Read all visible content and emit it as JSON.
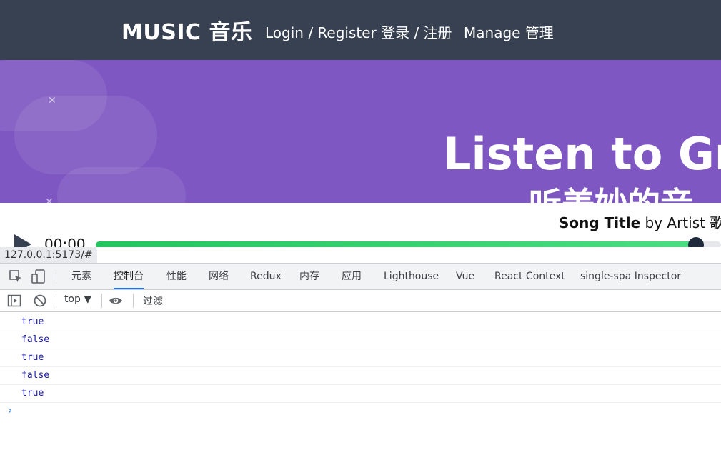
{
  "nav": {
    "brand": "MUSIC 音乐",
    "login": "Login / Register 登录 / 注册",
    "manage": "Manage 管理"
  },
  "hero": {
    "title": "Listen to Grea",
    "subtitle": "听美妙的音"
  },
  "player": {
    "song_title": "Song Title",
    "by_artist": " by Artist 歌手",
    "time": "00:00",
    "progress": 0.96,
    "progress_color": "#22c55e"
  },
  "status_url": "127.0.0.1:5173/#",
  "devtools": {
    "tabs": [
      "元素",
      "控制台",
      "性能",
      "网络",
      "Redux",
      "内存",
      "应用",
      "Lighthouse",
      "Vue",
      "React Context",
      "single-spa Inspector"
    ],
    "active_tab": "控制台",
    "context": "top ▼",
    "filter_placeholder": "过滤",
    "logs": [
      "true",
      "false",
      "true",
      "false",
      "true"
    ],
    "prompt": "›",
    "accent": "#1a73e8"
  }
}
